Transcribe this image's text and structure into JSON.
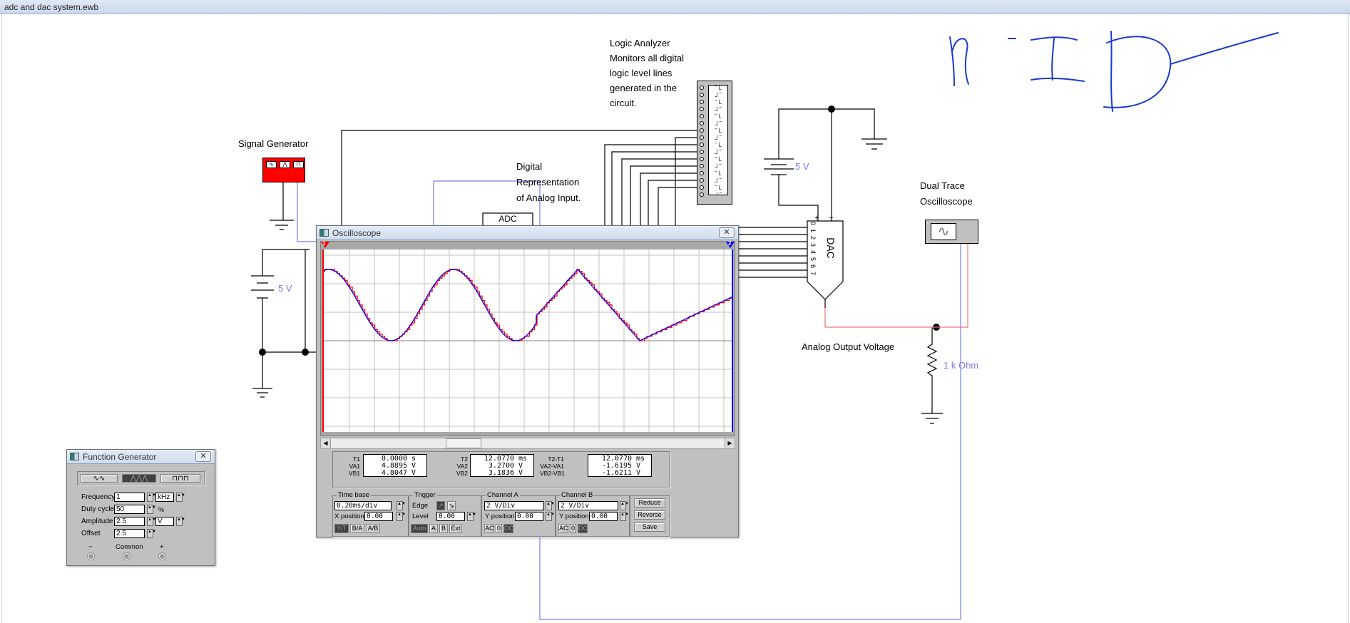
{
  "window_title": "adc and dac system.ewb",
  "schematic": {
    "signal_generator_label": "Signal Generator",
    "logic_analyzer_label": "Logic Analyzer\nMonitors all digital\nlogic level lines\ngenerated in the\ncircuit.",
    "digital_rep_label": "Digital\nRepresentation\nof Analog Input.",
    "adc_label": "ADC",
    "dac_label": "DAC",
    "dac_pins": [
      "0",
      "1",
      "2",
      "3",
      "4",
      "5",
      "6",
      "7"
    ],
    "dac_plus": "+",
    "dac_minus": "−",
    "battery_right_label": "5 V",
    "battery_left_label": "5 V",
    "dual_trace_label": "Dual Trace\nOscilloscope",
    "analog_output_label": "Analog Output Voltage",
    "resistor_label": "1 k Ohm"
  },
  "oscilloscope": {
    "title": "Oscilloscope",
    "close_glyph": "✕",
    "cursor1_label": "1",
    "cursor2_label": "2",
    "readouts": {
      "t1": {
        "label": "T1",
        "value": "0.0000",
        "unit": "s"
      },
      "va1": {
        "label": "VA1",
        "value": "4.8895",
        "unit": "V"
      },
      "vb1": {
        "label": "VB1",
        "value": "4.8047",
        "unit": "V"
      },
      "t2": {
        "label": "T2",
        "value": "12.0770",
        "unit": "ms"
      },
      "va2": {
        "label": "VA2",
        "value": "3.2700",
        "unit": "V"
      },
      "vb2": {
        "label": "VB2",
        "value": "3.1836",
        "unit": "V"
      },
      "dt": {
        "label": "T2-T1",
        "value": "12.0770",
        "unit": "ms"
      },
      "dva": {
        "label": "VA2-VA1",
        "value": "-1.6195",
        "unit": "V"
      },
      "dvb": {
        "label": "VB2-VB1",
        "value": "-1.6211",
        "unit": "V"
      }
    },
    "time_base": {
      "title": "Time base",
      "value": "0.20ms/div",
      "xpos_label": "X position",
      "xpos": "0.00",
      "modes": [
        "Y/T",
        "B/A",
        "A/B"
      ],
      "active_mode": "Y/T"
    },
    "trigger": {
      "title": "Trigger",
      "edge_label": "Edge",
      "level_label": "Level",
      "level": "0.00",
      "sources": [
        "Auto",
        "A",
        "B",
        "Ext"
      ],
      "active_source": "Auto"
    },
    "channel_a": {
      "title": "Channel A",
      "scale": "2 V/Div",
      "ypos_label": "Y position",
      "ypos": "0.00",
      "coupling": [
        "AC",
        "0",
        "DC"
      ],
      "active_coupling": "DC"
    },
    "channel_b": {
      "title": "Channel B",
      "scale": "2 V/Div",
      "ypos_label": "Y position",
      "ypos": "0.00",
      "coupling": [
        "AC",
        "0",
        "DC"
      ],
      "active_coupling": "DC"
    },
    "buttons": [
      "Reduce",
      "Reverse",
      "Save"
    ],
    "colors": {
      "channel_a": "#ff0000",
      "channel_b": "#0000ff",
      "grid": "#c0c0c0"
    },
    "trace_ms_volts": {
      "time_per_div_ms": 0.2,
      "volts_per_div": 2,
      "channel_b": [
        [
          0,
          4.9
        ],
        [
          0.05,
          5.0
        ],
        [
          0.3,
          2.5
        ],
        [
          0.55,
          0.0
        ],
        [
          0.8,
          2.5
        ],
        [
          1.05,
          5.0
        ],
        [
          1.3,
          2.5
        ],
        [
          1.55,
          0.0
        ],
        [
          1.714,
          1.25
        ],
        [
          1.714,
          1.75
        ],
        [
          2.046,
          5.0
        ],
        [
          2.543,
          0.0
        ],
        [
          3.29,
          3.1
        ]
      ],
      "segments": [
        "sine",
        "sine",
        "sine",
        "sine",
        "sine",
        "sine",
        "sine",
        "sine",
        "step",
        "linear",
        "linear",
        "linear"
      ]
    }
  },
  "function_generator": {
    "title": "Function Generator",
    "close_glyph": "✕",
    "waveforms": [
      "sine",
      "triangle",
      "square"
    ],
    "active_waveform": "triangle",
    "frequency": {
      "label": "Frequency",
      "value": "1",
      "unit": "kHz"
    },
    "duty_cycle": {
      "label": "Duty cycle",
      "value": "50",
      "unit": "%"
    },
    "amplitude": {
      "label": "Amplitude",
      "value": "2.5",
      "unit": "V"
    },
    "offset": {
      "label": "Offset",
      "value": "2.5"
    },
    "terminals": [
      "−",
      "Common",
      "+"
    ]
  }
}
